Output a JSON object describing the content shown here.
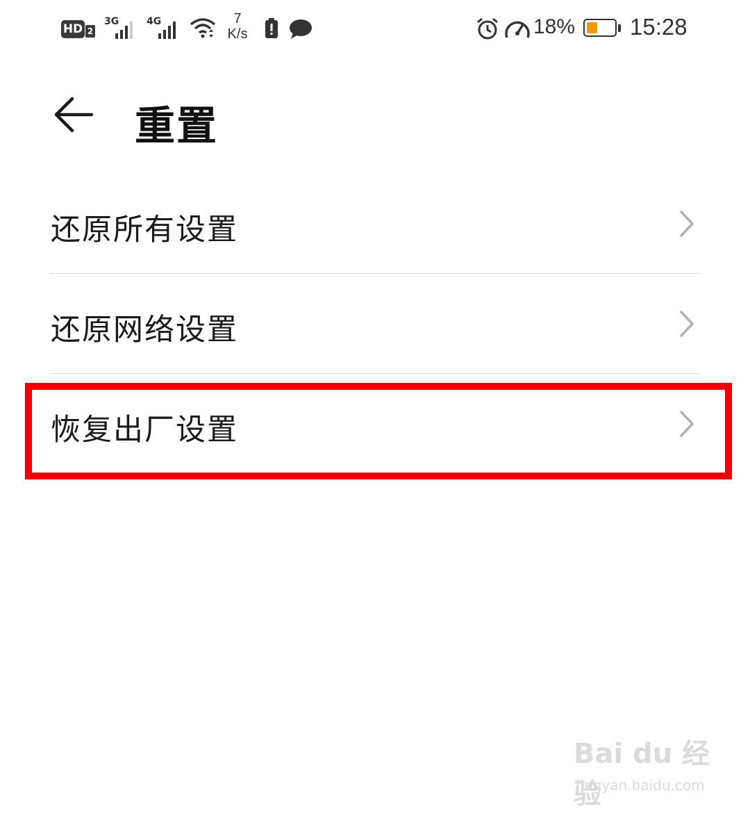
{
  "status_bar": {
    "hd": "HD",
    "sim_slot": "2",
    "network_1": "3G",
    "network_2": "4G",
    "speed_value": "7",
    "speed_unit": "K/s",
    "battery_percent": "18%",
    "battery_level": 0.18,
    "time": "15:28"
  },
  "header": {
    "back_icon": "arrow-left-icon",
    "title": "重置"
  },
  "list": {
    "items": [
      {
        "label": "还原所有设置",
        "icon": "chevron-right-icon"
      },
      {
        "label": "还原网络设置",
        "icon": "chevron-right-icon"
      },
      {
        "label": "恢复出厂设置",
        "icon": "chevron-right-icon",
        "highlighted": true
      }
    ]
  },
  "colors": {
    "highlight": "#ee0000",
    "battery_fill": "#f39800",
    "chevron": "#b0b0b0"
  },
  "watermark": {
    "logo": "Bai du 经验",
    "url": "jingyan.baidu.com"
  }
}
